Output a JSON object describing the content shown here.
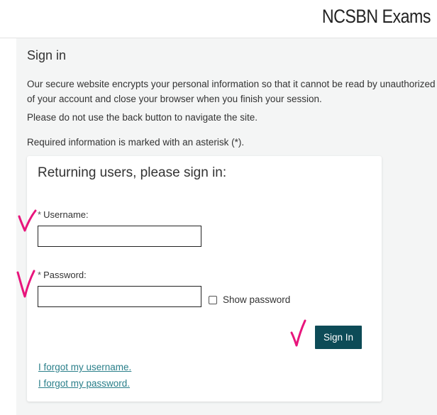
{
  "header": {
    "brand": "NCSBN Exams"
  },
  "page": {
    "title": "Sign in",
    "intro_line1": "Our secure website encrypts your personal information so that it cannot be read by unauthorized",
    "intro_line2": "of your account and close your browser when you finish your session.",
    "note_back_button": "Please do not use the back button to navigate the site.",
    "note_required": "Required information is marked with an asterisk (*)."
  },
  "form": {
    "heading": "Returning users, please sign in:",
    "required_marker": "*",
    "username_label": "Username:",
    "username_value": "",
    "password_label": "Password:",
    "password_value": "",
    "show_password_label": "Show password",
    "show_password_checked": false,
    "submit_label": "Sign In",
    "forgot_username": "I forgot my username.",
    "forgot_password": "I forgot my password."
  },
  "annotations": {
    "checkmark_color": "#e8157c"
  },
  "colors": {
    "button_bg": "#0d4b57",
    "link": "#2a7f8a",
    "panel_bg": "#f4f5f5"
  }
}
